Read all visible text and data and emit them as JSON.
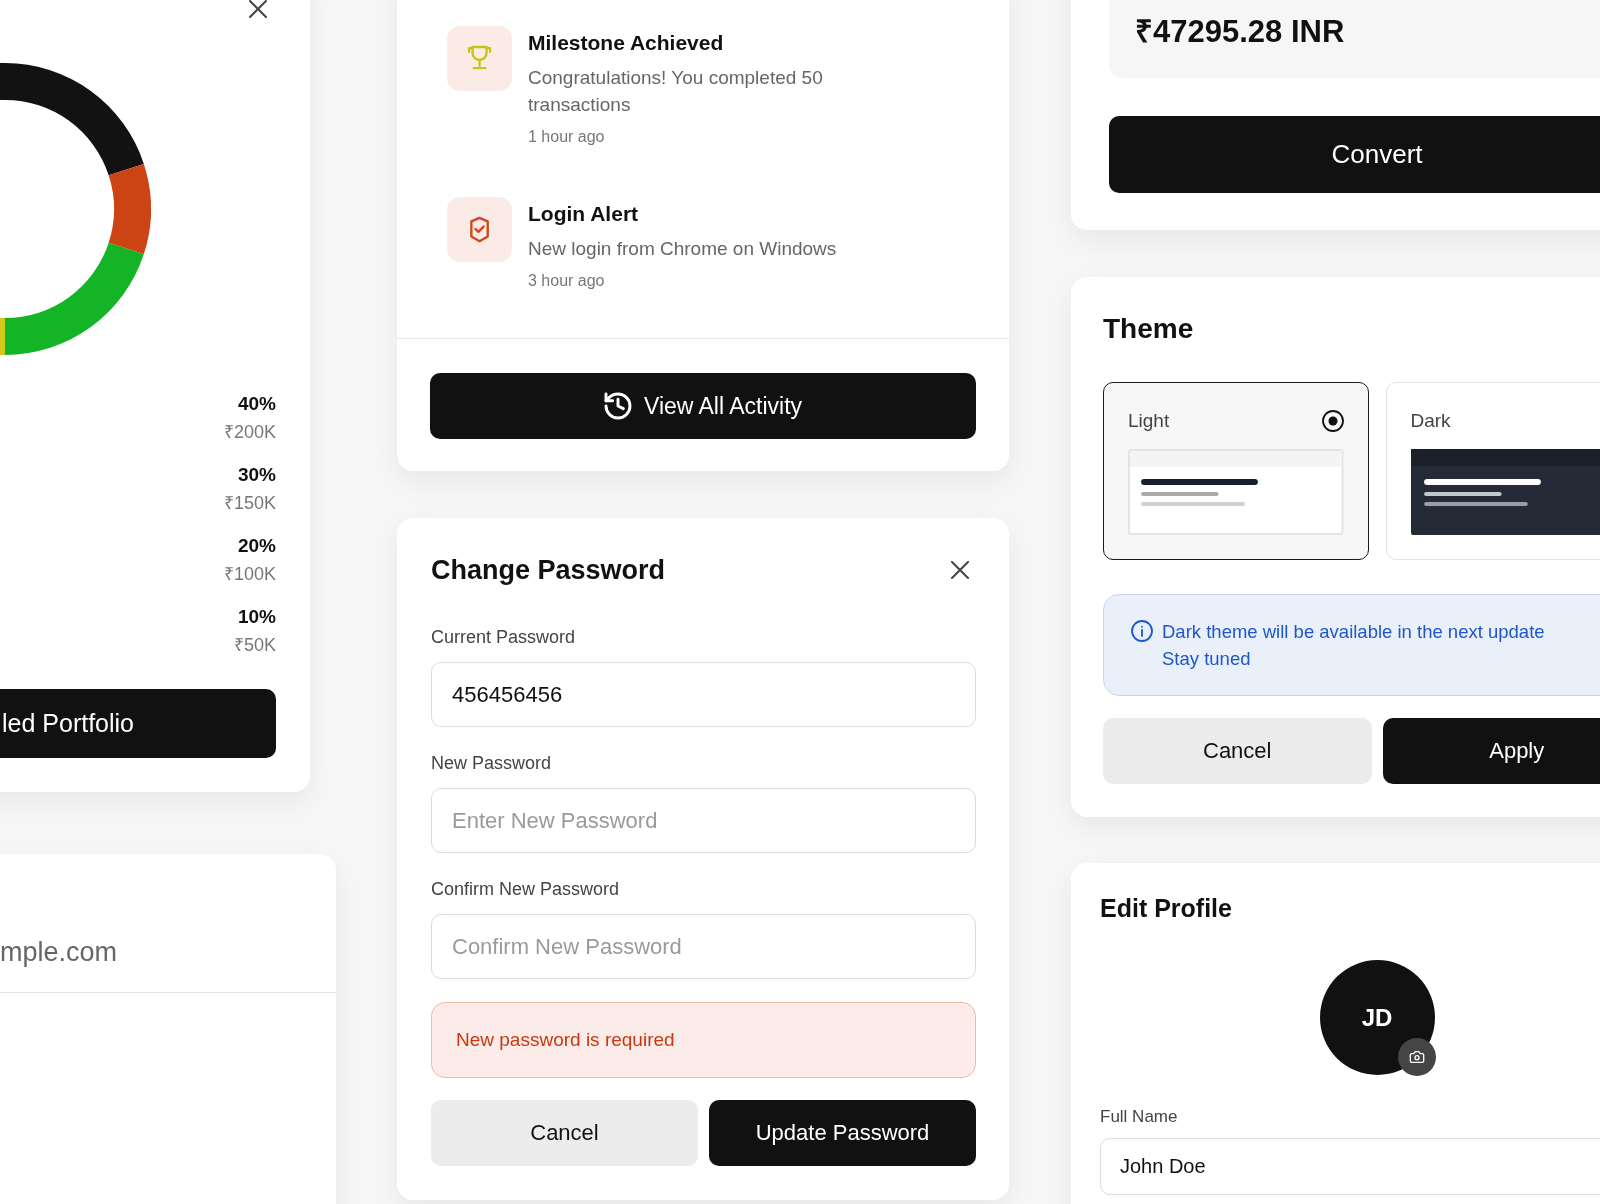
{
  "portfolio_card": {
    "chart_data": [
      {
        "type": "donut",
        "values": [
          40,
          30,
          20,
          10
        ],
        "colors": [
          "#121212",
          "#d3ca1d",
          "#13b527",
          "#cc4414"
        ]
      }
    ],
    "legend": [
      {
        "percent": "40%",
        "amount": "₹200K"
      },
      {
        "percent": "30%",
        "amount": "₹150K"
      },
      {
        "percent": "20%",
        "amount": "₹100K"
      },
      {
        "percent": "10%",
        "amount": "₹50K"
      }
    ],
    "button": "led Portfolio"
  },
  "account_card": {
    "email": "mple.com"
  },
  "activity_card": {
    "items": [
      {
        "kind": "milestone",
        "title": "Milestone Achieved",
        "description": "Congratulations! You completed 50 transactions",
        "time": "1 hour ago"
      },
      {
        "kind": "security",
        "title": "Login Alert",
        "description": "New login from Chrome on Windows",
        "time": "3 hour ago"
      }
    ],
    "button": "View All Activity"
  },
  "change_password": {
    "title": "Change Password",
    "fields": [
      {
        "label": "Current Password",
        "value": "456456456"
      },
      {
        "label": "New Password",
        "placeholder": "Enter New Password"
      },
      {
        "label": "Confirm New Password",
        "placeholder": "Confirm New Password"
      }
    ],
    "error": "New password is required",
    "buttons": [
      {
        "label": "Cancel",
        "kind": "secondary"
      },
      {
        "label": "Update Password",
        "kind": "primary"
      }
    ]
  },
  "converter_card": {
    "result": "₹47295.28 INR",
    "button": "Convert"
  },
  "theme_card": {
    "title": "Theme",
    "options": [
      {
        "label": "Light",
        "kind": "light",
        "selected": true
      },
      {
        "label": "Dark",
        "kind": "dark",
        "selected": false
      }
    ],
    "notice": [
      "Dark theme will be available in the next update",
      "Stay tuned"
    ],
    "buttons": [
      {
        "label": "Cancel",
        "kind": "secondary"
      },
      {
        "label": "Apply",
        "kind": "primary"
      }
    ]
  },
  "edit_profile": {
    "title": "Edit Profile",
    "initials": "JD",
    "fields": [
      {
        "label": "Full Name",
        "value": "John Doe"
      }
    ]
  }
}
